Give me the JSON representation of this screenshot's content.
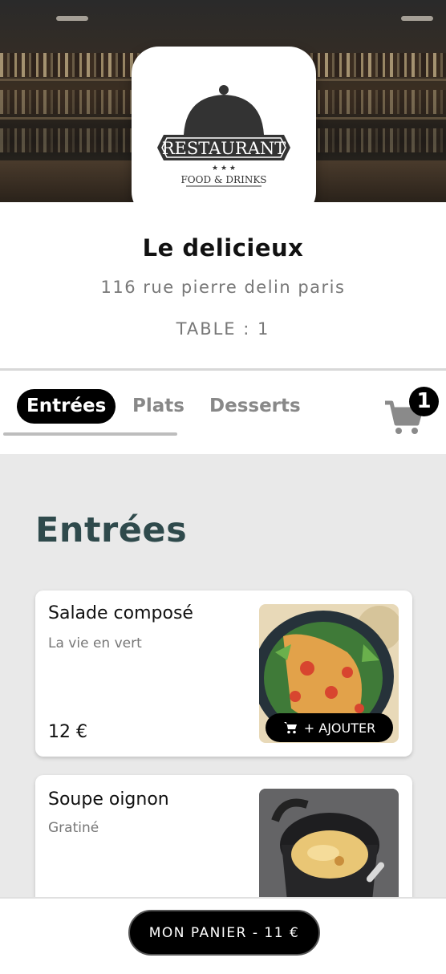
{
  "restaurant": {
    "logo_text": "RESTAURANT",
    "logo_subtext": "FOOD & DRINKS",
    "name": "Le delicieux",
    "address": "116 rue pierre delin paris",
    "table": "TABLE : 1"
  },
  "tabs": [
    {
      "label": "Entrées",
      "active": true
    },
    {
      "label": "Plats",
      "active": false
    },
    {
      "label": "Desserts",
      "active": false
    }
  ],
  "cart": {
    "count": "1",
    "icon": "cart-icon"
  },
  "section": {
    "title": "Entrées"
  },
  "items": [
    {
      "name": "Salade composé",
      "description": "La vie en vert",
      "price": "12 €",
      "add_label": "+ AJOUTER"
    },
    {
      "name": "Soupe oignon",
      "description": "Gratiné",
      "price": "",
      "add_label": ""
    }
  ],
  "bottom": {
    "panier_label": "MON PANIER - 11 €"
  },
  "colors": {
    "accent": "#000000",
    "section_title": "#2f4a4c",
    "background": "#e9e9e9"
  }
}
